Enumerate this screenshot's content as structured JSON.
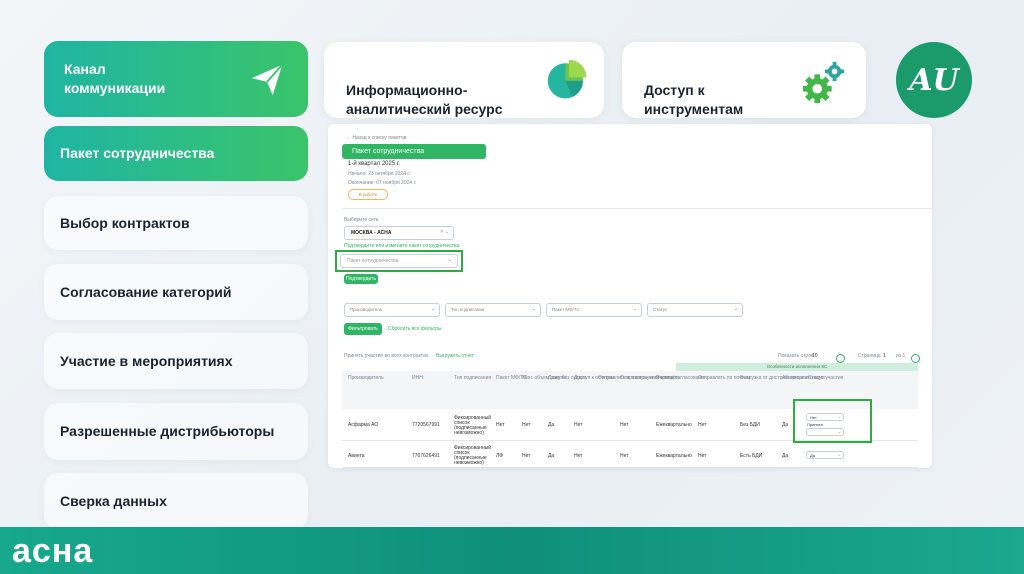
{
  "sidebar": {
    "items": [
      {
        "label": "Канал\nкоммуникации"
      },
      {
        "label": "Пакет сотрудничества"
      },
      {
        "label": "Выбор контрактов"
      },
      {
        "label": "Согласование категорий"
      },
      {
        "label": "Участие в мероприятиях"
      },
      {
        "label": "Разрешенные дистрибьюторы"
      },
      {
        "label": "Сверка данных"
      }
    ]
  },
  "cards": {
    "analytics": "Информационно-\nаналитический ресурс",
    "tools": "Доступ к\nинструментам"
  },
  "brand": {
    "logo_text": "асна",
    "circle_text": "AU"
  },
  "screenshot": {
    "back_link": "← Назад к списку пакетов",
    "package_title": "Пакет сотрудничества",
    "quarter": "1-й квартал 2025 г.",
    "start": "Начало: 23 октября 2024 г.",
    "end": "Окончание: 07 ноября 2024 г.",
    "status_badge": "В работе",
    "group_label": "Выберите сеть",
    "group_value": "МОСКВА - АСНА",
    "confirm_hint": "Подтвердите или измените пакет сотрудничества",
    "package_placeholder": "Пакет сотрудничества",
    "confirm_button": "Подтвердить",
    "filters": [
      "Производитель",
      "Тип подписания",
      "Пакет МФ/ТС",
      "Статус"
    ],
    "filter_button": "Фильтровать",
    "reset_link": "Сбросить все фильтры",
    "apply_all": "Принять участие во всех контрактах",
    "download": "Выгрузить отчет",
    "page_size_label": "Показать строк",
    "page_size": "10",
    "page_label": "Страница",
    "page_value": "1",
    "page_of": "из 1",
    "columns": [
      "Производитель",
      "ИНН",
      "Тип подписания",
      "Пакет МФ/ТС",
      "Мин. объем закупа",
      "Даже без скидки",
      "Доступ к отчетам",
      "Отправлять в товарную отчетность",
      "Отправлять чеки в отчёт",
      "Период согласования",
      "Отправлять по почтам",
      "Выгрузка от дистрибьюторов",
      "Активные позиции",
      "Статус участия"
    ],
    "group_header": "Особенности исполнения КС",
    "rows": [
      {
        "maker": "Асфарма АО",
        "inn": "7720567991",
        "type": "Фиксированный список (подписанные невозможно)",
        "pack": "Нет",
        "min": "Нет",
        "nodisc": "Да",
        "rep": "Нет",
        "goods": "Нет",
        "checks": "Нет",
        "period": "Ежеквартально",
        "mail": "Нет",
        "dist": "Без БДИ",
        "active": "Да",
        "status": "Нет",
        "status2": "Принята"
      },
      {
        "maker": "Авинта",
        "inn": "7707626491",
        "type": "Фиксированный список (подписанные невозможно)",
        "pack": "ЛФ",
        "min": "Нет",
        "nodisc": "Да",
        "rep": "Нет",
        "goods": "Нет",
        "checks": "Нет",
        "period": "Ежеквартально",
        "mail": "Нет",
        "dist": "Есть БДИ",
        "active": "Да",
        "status": "Да",
        "status2": ""
      }
    ]
  },
  "colors": {
    "accent_green": "#2fb564",
    "teal": "#17a88d",
    "brand_dark": "#1b9a6c"
  }
}
